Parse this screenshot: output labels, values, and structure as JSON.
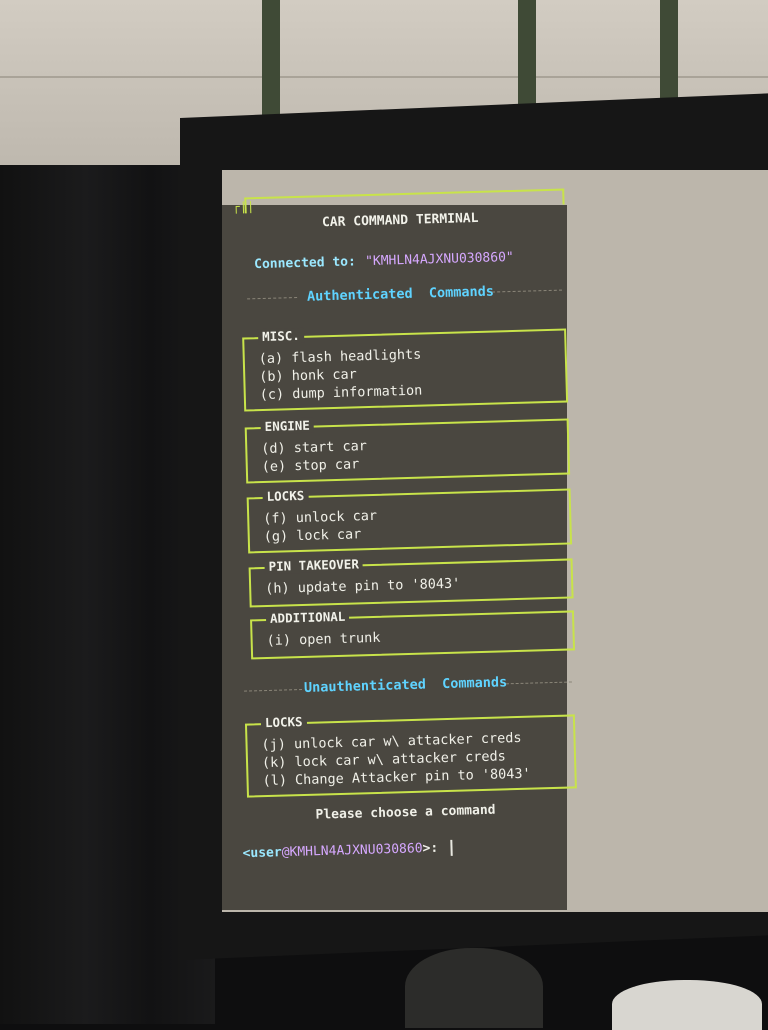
{
  "terminal": {
    "title": "CAR COMMAND TERMINAL",
    "connected_label": "Connected to: ",
    "connected_vin": "\"KMHLN4AJXNU030860\"",
    "authenticated_header": "Authenticated  Commands",
    "unauthenticated_header": "Unauthenticated  Commands",
    "choose_prompt": "Please choose a command",
    "prompt": {
      "user": "<user",
      "host": "@KMHLN4AJXNU030860",
      "rest": ">: "
    }
  },
  "sections": [
    {
      "title": "MISC.",
      "items": [
        "(a) flash headlights",
        "(b) honk car",
        "(c) dump information"
      ]
    },
    {
      "title": "ENGINE",
      "items": [
        "(d) start car",
        "(e) stop car"
      ]
    },
    {
      "title": "LOCKS",
      "items": [
        "(f) unlock car",
        "(g) lock car"
      ]
    },
    {
      "title": "PIN TAKEOVER",
      "items": [
        "(h) update pin to '8043'"
      ]
    },
    {
      "title": "ADDITIONAL",
      "items": [
        "(i) open trunk"
      ]
    }
  ],
  "unauth_sections": [
    {
      "title": "LOCKS",
      "items": [
        "(j) unlock car w\\ attacker creds",
        "(k) lock car w\\ attacker creds",
        "(l) Change Attacker pin to '8043'"
      ]
    }
  ],
  "colors": {
    "border": "#c8e34a",
    "header": "#5fd3ff",
    "vin": "#d6a8ff",
    "terminal_bg": "#4a4740"
  }
}
